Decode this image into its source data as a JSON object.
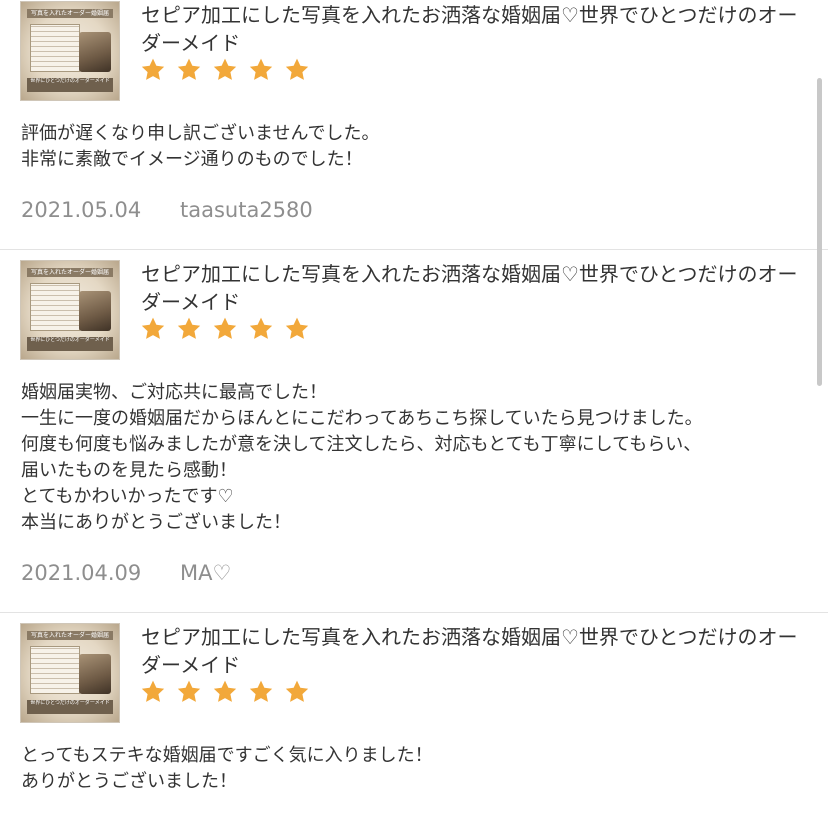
{
  "accent_color": "#f2a83a",
  "reviews": [
    {
      "thumbnail": {
        "banner_text": "写真を入れたオーダー婚姻届",
        "caption_text": "世界にひとつだけのオーダーメイド"
      },
      "product_title": "セピア加工にした写真を入れたお洒落な婚姻届♡世界でひとつだけのオーダーメイド",
      "rating": 5,
      "comment_lines": [
        "評価が遅くなり申し訳ございませんでした。",
        "非常に素敵でイメージ通りのものでした！"
      ],
      "date": "2021.05.04",
      "user": "taasuta2580"
    },
    {
      "thumbnail": {
        "banner_text": "写真を入れたオーダー婚姻届",
        "caption_text": "世界にひとつだけのオーダーメイド"
      },
      "product_title": "セピア加工にした写真を入れたお洒落な婚姻届♡世界でひとつだけのオーダーメイド",
      "rating": 5,
      "comment_lines": [
        "婚姻届実物、ご対応共に最高でした！",
        "一生に一度の婚姻届だからほんとにこだわってあちこち探していたら見つけました。",
        "何度も何度も悩みましたが意を決して注文したら、対応もとても丁寧にしてもらい、",
        "届いたものを見たら感動！",
        "とてもかわいかったです♡",
        "本当にありがとうございました！"
      ],
      "date": "2021.04.09",
      "user": "MA♡"
    },
    {
      "thumbnail": {
        "banner_text": "写真を入れたオーダー婚姻届",
        "caption_text": "世界にひとつだけのオーダーメイド"
      },
      "product_title": "セピア加工にした写真を入れたお洒落な婚姻届♡世界でひとつだけのオーダーメイド",
      "rating": 5,
      "comment_lines": [
        "とってもステキな婚姻届ですごく気に入りました！",
        "ありがとうございました！"
      ],
      "date": "",
      "user": ""
    }
  ]
}
